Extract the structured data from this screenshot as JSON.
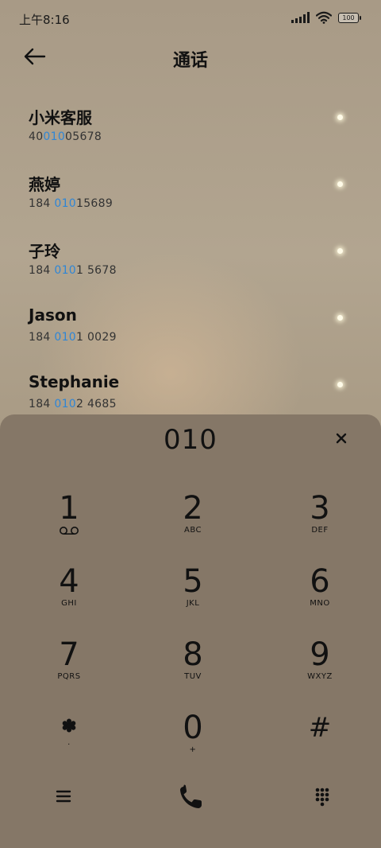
{
  "status_bar": {
    "time": "上午8:16",
    "battery": "100"
  },
  "header": {
    "title": "通话"
  },
  "contacts": [
    {
      "name": "小米客服",
      "pre": "40",
      "match": "010",
      "post": "05678"
    },
    {
      "name": "燕婷",
      "pre": "184 ",
      "match": "010",
      "post": "15689"
    },
    {
      "name": "子玲",
      "pre": "184 ",
      "match": "010",
      "post": "1 5678"
    },
    {
      "name": "Jason",
      "pre": "184 ",
      "match": "010",
      "post": "1 0029"
    },
    {
      "name": "Stephanie",
      "pre": "184 ",
      "match": "010",
      "post": "2 4685"
    }
  ],
  "dialpad": {
    "input": "010",
    "keys": [
      {
        "digit": "1",
        "letters": ""
      },
      {
        "digit": "2",
        "letters": "ABC"
      },
      {
        "digit": "3",
        "letters": "DEF"
      },
      {
        "digit": "4",
        "letters": "GHI"
      },
      {
        "digit": "5",
        "letters": "JKL"
      },
      {
        "digit": "6",
        "letters": "MNO"
      },
      {
        "digit": "7",
        "letters": "PQRS"
      },
      {
        "digit": "8",
        "letters": "TUV"
      },
      {
        "digit": "9",
        "letters": "WXYZ"
      },
      {
        "digit": "",
        "letters": "·"
      },
      {
        "digit": "0",
        "letters": "+"
      },
      {
        "digit": "#",
        "letters": ""
      }
    ]
  },
  "icons": {
    "back": "arrow-left-icon",
    "clear": "close-icon",
    "voicemail": "voicemail-icon",
    "star": "asterisk-icon",
    "menu": "menu-icon",
    "call": "phone-icon",
    "keypad": "keypad-icon"
  },
  "colors": {
    "match_highlight": "#2f86d6",
    "panel": "#857767"
  }
}
